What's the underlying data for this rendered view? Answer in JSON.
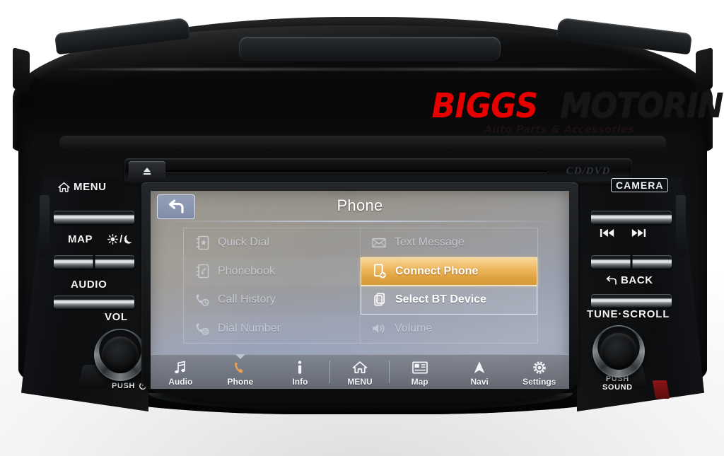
{
  "watermark": {
    "brand_first": "BIGGS",
    "brand_second": "MOTORING",
    "tagline": "Auto Parts & Accessories",
    "brand_first_color": "#e60000",
    "brand_second_color": "#161616"
  },
  "hardware": {
    "cd": {
      "eject_icon": "eject-icon",
      "disc_logo": "CD/DVD"
    },
    "left_controls": [
      {
        "label": "MENU",
        "icon": "home-icon",
        "type": "button"
      },
      {
        "label": "MAP",
        "secondary_label": "",
        "icon": "brightness-day-night-icon",
        "type": "split-button"
      },
      {
        "label": "AUDIO",
        "icon": "",
        "type": "button"
      },
      {
        "label": "VOL",
        "icon": "knob",
        "type": "knob",
        "sub_label": "PUSH",
        "sub_icon": "power-icon"
      }
    ],
    "right_controls": [
      {
        "label": "CAMERA",
        "icon": "",
        "type": "boxed-button"
      },
      {
        "label": "",
        "icon": "prev-track-icon",
        "secondary_icon": "next-track-icon",
        "type": "split-button"
      },
      {
        "label": "BACK",
        "icon": "back-arrow-icon",
        "type": "button"
      },
      {
        "label": "TUNE·SCROLL",
        "icon": "knob",
        "type": "knob",
        "sub_label_1": "PUSH",
        "sub_label_2": "SOUND"
      }
    ]
  },
  "screen": {
    "back_button_icon": "back-arrow-icon",
    "title": "Phone",
    "menu_items": [
      {
        "label": "Quick Dial",
        "icon": "quick-dial-icon",
        "state": "dim",
        "column": "left"
      },
      {
        "label": "Text Message",
        "icon": "envelope-icon",
        "state": "dim",
        "column": "right"
      },
      {
        "label": "Phonebook",
        "icon": "phonebook-icon",
        "state": "dim",
        "column": "left"
      },
      {
        "label": "Connect Phone",
        "icon": "connect-phone-icon",
        "state": "selected",
        "column": "right"
      },
      {
        "label": "Call History",
        "icon": "call-history-icon",
        "state": "dim",
        "column": "left"
      },
      {
        "label": "Select BT Device",
        "icon": "bt-device-icon",
        "state": "outlined",
        "column": "right"
      },
      {
        "label": "Dial Number",
        "icon": "dial-number-icon",
        "state": "dim",
        "column": "left"
      },
      {
        "label": "Volume",
        "icon": "speaker-icon",
        "state": "dim",
        "column": "right"
      }
    ],
    "tabbar": [
      {
        "label": "Audio",
        "icon": "music-note-icon",
        "active": false
      },
      {
        "label": "Phone",
        "icon": "handset-icon",
        "active": true
      },
      {
        "label": "Info",
        "icon": "info-icon",
        "active": false
      },
      {
        "label": "MENU",
        "icon": "home-icon",
        "active": false
      },
      {
        "label": "Map",
        "icon": "map-card-icon",
        "active": false
      },
      {
        "label": "Navi",
        "icon": "nav-arrow-icon",
        "active": false
      },
      {
        "label": "Settings",
        "icon": "gear-icon",
        "active": false
      }
    ],
    "colors": {
      "selected_accent": "#e0a341",
      "outline": "#dfe7f6",
      "active_tab_icon": "#e9a24e"
    }
  }
}
